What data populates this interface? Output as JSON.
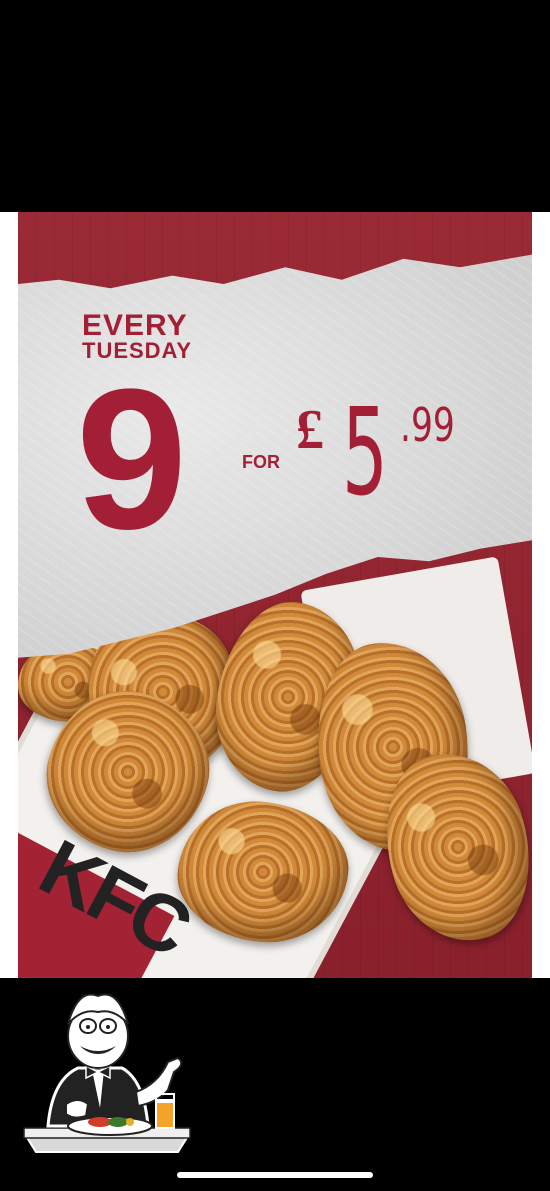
{
  "promo": {
    "line1": "EVERY",
    "line2": "TUESDAY",
    "quantity": "9",
    "for_word": "FOR",
    "currency": "£",
    "price_main": "5",
    "price_cents": ".99",
    "brand": "KFC"
  },
  "icons": {
    "sound": "speaker-volume-icon",
    "diner": "restaurant-diner-icon"
  },
  "colors": {
    "brand_red": "#a31f36",
    "background": "#000000"
  }
}
